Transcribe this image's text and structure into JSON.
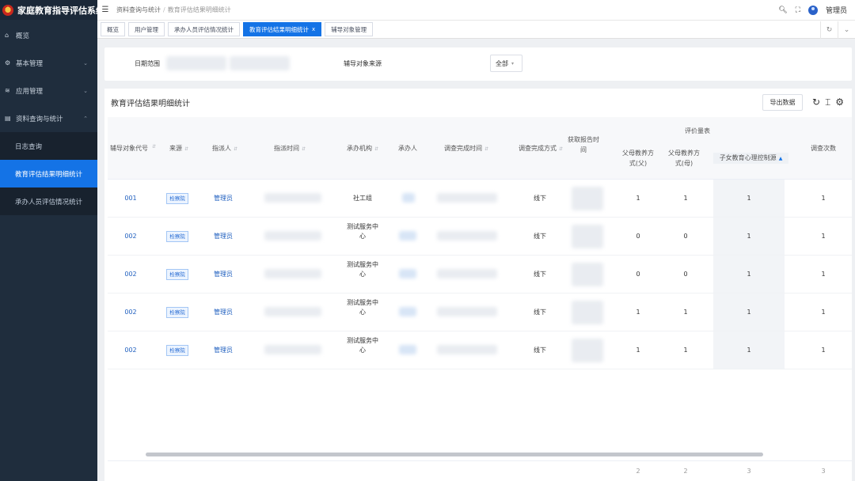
{
  "app": {
    "title": "家庭教育指导评估系统"
  },
  "sidebar": {
    "items": [
      {
        "label": "概览",
        "icon": "home-icon"
      },
      {
        "label": "基本管理",
        "icon": "gear-icon"
      },
      {
        "label": "应用管理",
        "icon": "layers-icon"
      },
      {
        "label": "资料查询与统计",
        "icon": "folder-icon"
      }
    ],
    "sub_items": [
      {
        "label": "日志查询"
      },
      {
        "label": "教育评估结果明细统计"
      },
      {
        "label": "承办人员评估情况统计"
      }
    ]
  },
  "breadcrumb": {
    "parent": "资料查询与统计",
    "current": "教育评估结果明细统计"
  },
  "header": {
    "user": "管理员"
  },
  "tags": [
    {
      "label": "概览"
    },
    {
      "label": "用户管理"
    },
    {
      "label": "承办人员评估情况统计"
    },
    {
      "label": "教育评估结果明细统计",
      "close": "x"
    },
    {
      "label": "辅导对象管理"
    }
  ],
  "filter": {
    "date_label": "日期范围",
    "source_label": "辅导对象来源",
    "source_value": "全部"
  },
  "card": {
    "title": "教育评估结果明细统计",
    "export_label": "导出数据"
  },
  "table": {
    "group_header": "评价量表",
    "headers": {
      "code": "辅导对象代号",
      "source": "来源",
      "assigner": "指派人",
      "assign_time": "指派时间",
      "org": "承办机构",
      "handler": "承办人",
      "survey_time": "调查完成时间",
      "survey_method": "调查完成方式",
      "report_time": "获取报告时间",
      "father": "父母教养方式(父)",
      "mother": "父母教养方式(母)",
      "child": "子女教育心理控制源",
      "count": "调查次数"
    },
    "rows": [
      {
        "code": "001",
        "source": "检察院",
        "assigner": "管理员",
        "org": "社工组",
        "method": "线下",
        "father": "1",
        "mother": "1",
        "child": "1",
        "count": "1"
      },
      {
        "code": "002",
        "source": "检察院",
        "assigner": "管理员",
        "org": "测试服务中心",
        "method": "线下",
        "father": "0",
        "mother": "0",
        "child": "1",
        "count": "1"
      },
      {
        "code": "002",
        "source": "检察院",
        "assigner": "管理员",
        "org": "测试服务中心",
        "method": "线下",
        "father": "0",
        "mother": "0",
        "child": "1",
        "count": "1"
      },
      {
        "code": "002",
        "source": "检察院",
        "assigner": "管理员",
        "org": "测试服务中心",
        "method": "线下",
        "father": "1",
        "mother": "1",
        "child": "1",
        "count": "1"
      },
      {
        "code": "002",
        "source": "检察院",
        "assigner": "管理员",
        "org": "测试服务中心",
        "method": "线下",
        "father": "1",
        "mother": "1",
        "child": "1",
        "count": "1"
      }
    ],
    "totals": {
      "father": "2",
      "mother": "2",
      "child": "3",
      "count": "3"
    }
  }
}
